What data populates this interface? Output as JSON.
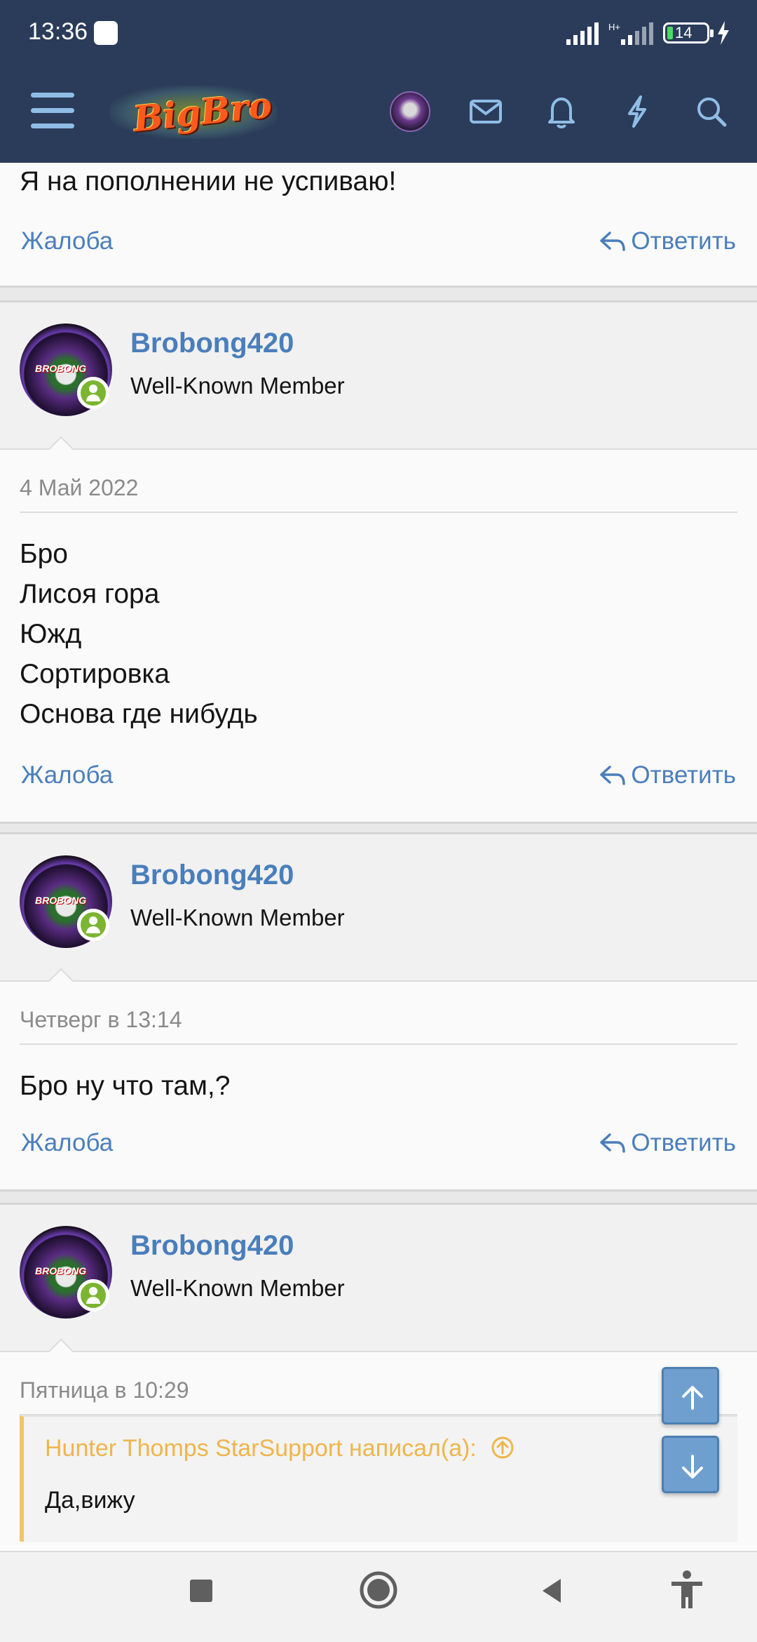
{
  "status_bar": {
    "time": "13:36",
    "network": "H+",
    "battery": "14"
  },
  "header": {
    "logo_text": "BigBro",
    "icons": [
      "menu-icon",
      "avatar",
      "mail-icon",
      "bell-icon",
      "lightning-icon",
      "search-icon"
    ]
  },
  "first_post": {
    "text": "Я на пополнении не успиваю!",
    "report_label": "Жалоба",
    "reply_label": "Ответить"
  },
  "posts": [
    {
      "username": "Brobong420",
      "user_title": "Well-Known Member",
      "date": "4 Май 2022",
      "lines": [
        "Бро",
        "Лисоя гора",
        "Южд",
        "Сортировка",
        "Основа где нибудь"
      ],
      "report_label": "Жалоба",
      "reply_label": "Ответить"
    },
    {
      "username": "Brobong420",
      "user_title": "Well-Known Member",
      "date": "Четверг в 13:14",
      "lines": [
        "Бро ну что там,?"
      ],
      "report_label": "Жалоба",
      "reply_label": "Ответить"
    },
    {
      "username": "Brobong420",
      "user_title": "Well-Known Member",
      "date": "Пятница в 10:29",
      "quote": {
        "author": "Hunter Thomps StarSupport написал(а):",
        "text": "Да,вижу"
      }
    }
  ],
  "colors": {
    "header_bg": "#2b3c5a",
    "link": "#4a7ebb",
    "quote_accent": "#efb54c",
    "online": "#7bb531"
  }
}
